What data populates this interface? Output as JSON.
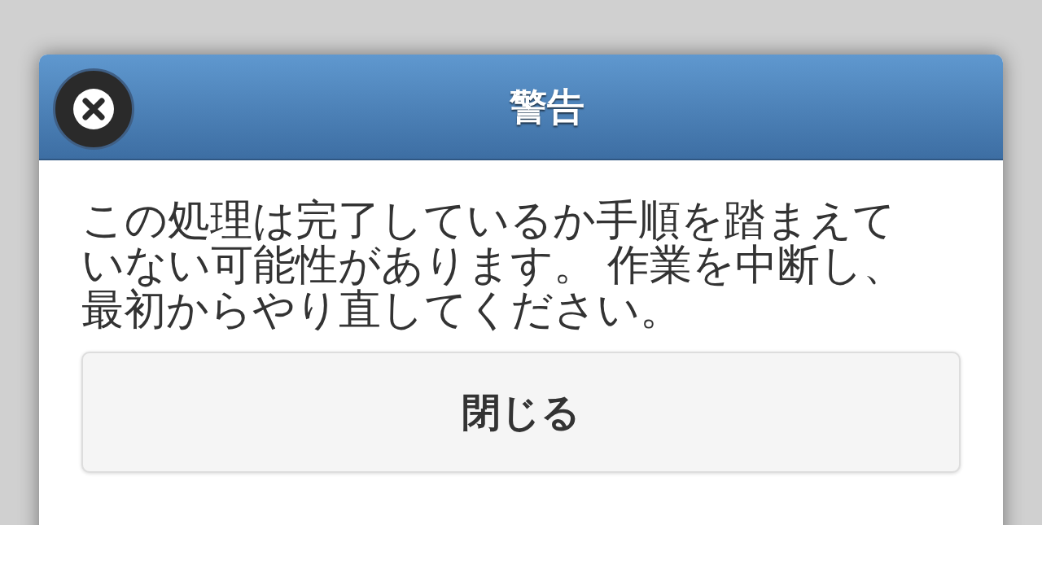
{
  "dialog": {
    "title": "警告",
    "message": "この処理は完了しているか手順を踏まえていない可能性があります。 作業を中断し、最初からやり直してください。",
    "button": "閉じる"
  }
}
